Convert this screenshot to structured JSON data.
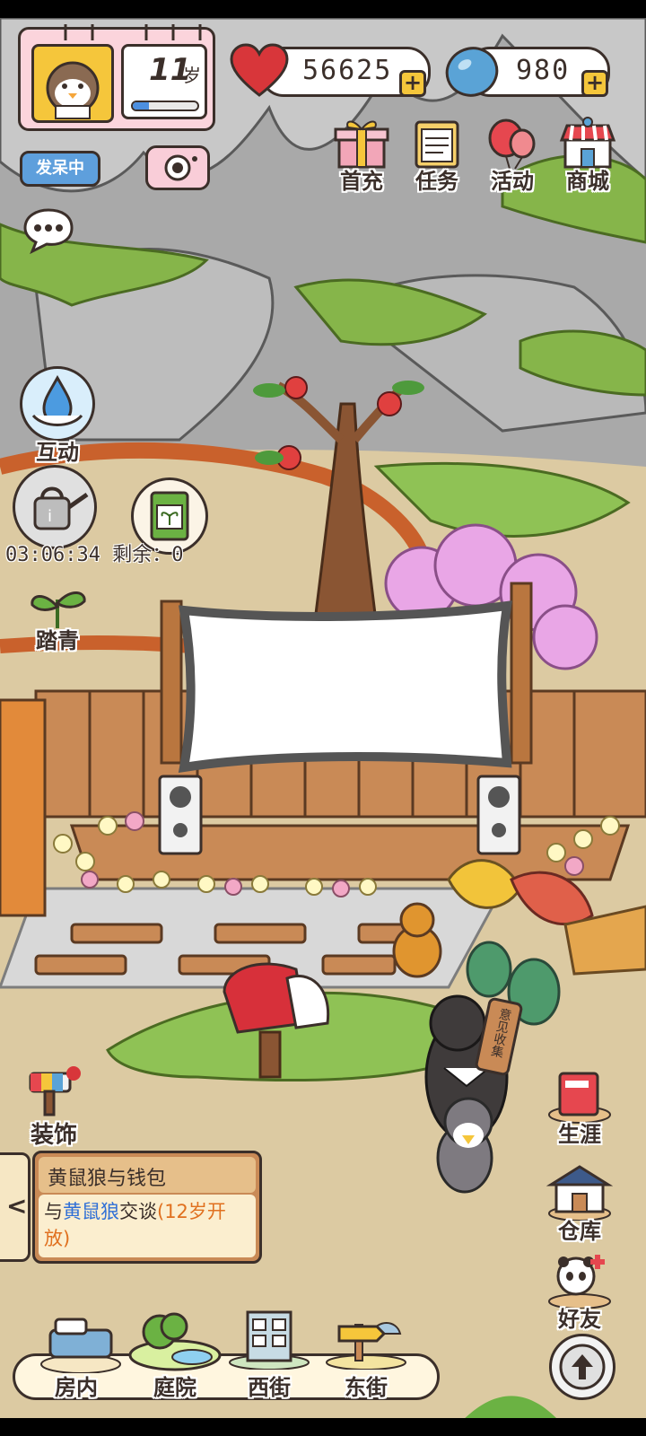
{
  "status": {
    "age_value": "11",
    "age_unit": "岁",
    "mood_badge": "发呆中",
    "age_progress": 0.25
  },
  "currency": {
    "hearts": "56625",
    "gems": "980",
    "add": "+"
  },
  "top_menu": [
    {
      "label": "首充",
      "icon": "gift-icon"
    },
    {
      "label": "任务",
      "icon": "clipboard-icon"
    },
    {
      "label": "活动",
      "icon": "balloon-icon"
    },
    {
      "label": "商城",
      "icon": "shop-icon"
    }
  ],
  "left_menu": {
    "interact": "互动",
    "timer": "03:06:34 剩余：0",
    "outing": "踏青",
    "decorate": "装饰"
  },
  "right_menu": {
    "career": "生涯",
    "warehouse": "仓库",
    "friends": "好友"
  },
  "quest": {
    "title": "黄鼠狼与钱包",
    "desc_prefix": "与",
    "desc_name": "黄鼠狼",
    "desc_mid": "交谈",
    "desc_req": "(12岁开放)",
    "collapse": "<"
  },
  "sign_text": "意见收集",
  "bottom_nav": [
    {
      "label": "房内"
    },
    {
      "label": "庭院"
    },
    {
      "label": "西街"
    },
    {
      "label": "东街"
    }
  ],
  "colors": {
    "outline": "#3b2f2a",
    "accent_yellow": "#f5c63b",
    "heart_red": "#d8363a",
    "gem_blue": "#5aa3d6",
    "quest_name_blue": "#2f6fd6",
    "quest_req_orange": "#e0701f"
  }
}
